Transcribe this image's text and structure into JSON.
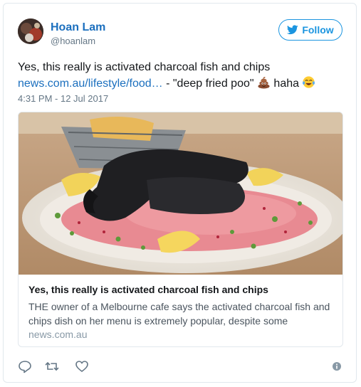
{
  "user": {
    "display_name": "Hoan Lam",
    "handle": "@hoanlam",
    "avatar_icon": "user-avatar"
  },
  "follow_button": {
    "label": "Follow",
    "icon": "twitter-bird-icon",
    "color": "#1b95e0"
  },
  "tweet": {
    "text_line1": "Yes, this really is activated charcoal fish and chips",
    "link_text": "news.com.au/lifestyle/food…",
    "text_after_link": " - \"deep fried poo\" ",
    "emoji1": "pile-of-poo-emoji",
    "text_haha": " haha ",
    "emoji2": "face-with-tears-of-joy-emoji",
    "timestamp": "4:31 PM - 12 Jul 2017"
  },
  "card": {
    "title": "Yes, this really is activated charcoal fish and chips",
    "description": "THE owner of a Melbourne cafe says the activated charcoal fish and chips dish on her menu is extremely popular, despite some",
    "domain": "news.com.au"
  },
  "actions": [
    {
      "name": "reply-icon"
    },
    {
      "name": "retweet-icon"
    },
    {
      "name": "like-icon"
    }
  ],
  "colors": {
    "link": "#1b6fbe",
    "secondary_text": "#657786",
    "border": "#e1e8ed"
  }
}
